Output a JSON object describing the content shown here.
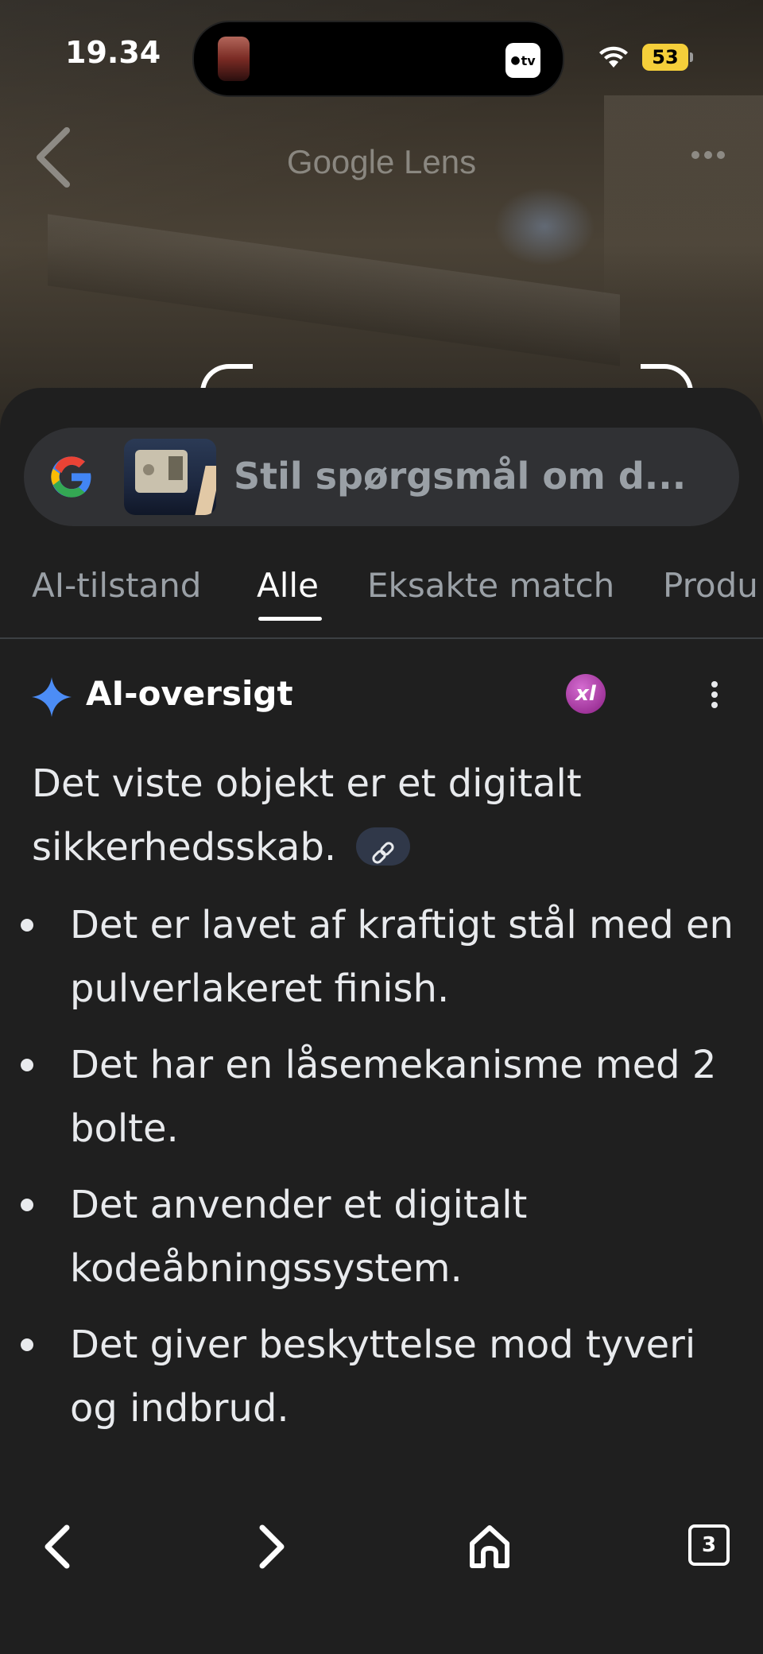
{
  "status_bar": {
    "time": "19.34",
    "tv_label": "tv",
    "battery": "53"
  },
  "header": {
    "title": "Google Lens"
  },
  "search": {
    "placeholder": "Stil spørgsmål om d..."
  },
  "tabs": [
    {
      "label": "AI-tilstand"
    },
    {
      "label": "Alle"
    },
    {
      "label": "Eksakte match"
    },
    {
      "label": "Produ"
    }
  ],
  "ai_overview": {
    "title": "AI-oversigt",
    "source_badge": "xl",
    "summary": "Det viste objekt er et digitalt sikkerhedsskab.",
    "bullets": [
      "Det er lavet af kraftigt stål med en pulverlakeret finish.",
      "Det har en låsemekanisme med 2 bolte.",
      "Det anvender et digitalt kodeåbningssystem.",
      "Det giver beskyttelse mod tyveri og indbrud."
    ]
  },
  "bottom_nav": {
    "tab_count": "3"
  },
  "colors": {
    "sheet_bg": "#1f1f1f",
    "search_bg": "#303134",
    "battery": "#f5cf3a",
    "gemini_blue": "#4c8df6"
  }
}
